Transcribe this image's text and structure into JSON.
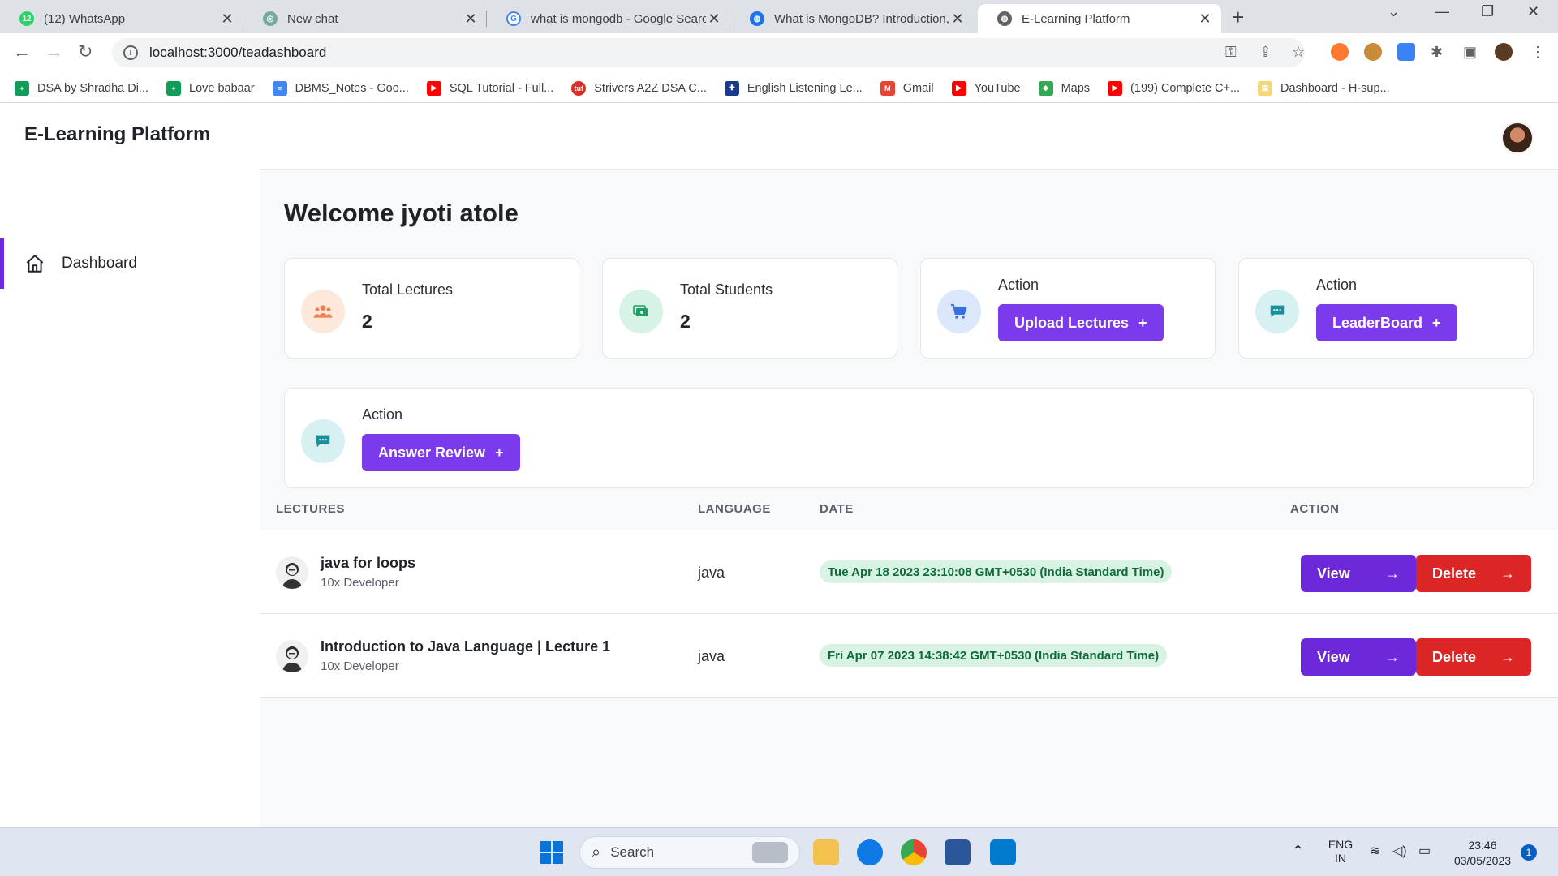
{
  "browser": {
    "tabs": [
      {
        "title": "(12) WhatsApp",
        "icon": "whatsapp-icon",
        "badge": "12"
      },
      {
        "title": "New chat",
        "icon": "chatgpt-icon"
      },
      {
        "title": "what is mongodb - Google Searc",
        "icon": "google-icon"
      },
      {
        "title": "What is MongoDB? Introduction,",
        "icon": "globe-icon"
      },
      {
        "title": "E-Learning Platform",
        "icon": "globe-icon",
        "active": true
      }
    ],
    "url": "localhost:3000/teadashboard",
    "bookmarks": [
      {
        "label": "DSA by Shradha Di...",
        "icon": "sheets-icon"
      },
      {
        "label": "Love babaar",
        "icon": "sheets-icon"
      },
      {
        "label": "DBMS_Notes - Goo...",
        "icon": "docs-icon"
      },
      {
        "label": "SQL Tutorial - Full...",
        "icon": "youtube-icon"
      },
      {
        "label": "Strivers A2Z DSA C...",
        "icon": "tuf-icon"
      },
      {
        "label": "English Listening Le...",
        "icon": "uk-flag-icon"
      },
      {
        "label": "Gmail",
        "icon": "gmail-icon"
      },
      {
        "label": "YouTube",
        "icon": "youtube-icon"
      },
      {
        "label": "Maps",
        "icon": "maps-icon"
      },
      {
        "label": "(199) Complete C+...",
        "icon": "youtube-icon"
      },
      {
        "label": "Dashboard - H-sup...",
        "icon": "dashboard-icon"
      }
    ]
  },
  "app": {
    "brand": "E-Learning Platform",
    "sidebar": {
      "items": [
        {
          "label": "Dashboard",
          "icon": "home-icon",
          "active": true
        }
      ]
    },
    "welcome": "Welcome jyoti atole",
    "stats": [
      {
        "label": "Total Lectures",
        "value": "2"
      },
      {
        "label": "Total Students",
        "value": "2"
      }
    ],
    "actions": [
      {
        "label": "Action",
        "button": "Upload Lectures",
        "plus": "+"
      },
      {
        "label": "Action",
        "button": "LeaderBoard",
        "plus": "+"
      },
      {
        "label": "Action",
        "button": "Answer Review",
        "plus": "+"
      }
    ],
    "table": {
      "headers": [
        "LECTURES",
        "LANGUAGE",
        "DATE",
        "ACTION"
      ],
      "rows": [
        {
          "title": "java for loops",
          "subtitle": "10x Developer",
          "language": "java",
          "date": "Tue Apr 18 2023 23:10:08 GMT+0530 (India Standard Time)",
          "view": "View",
          "delete": "Delete"
        },
        {
          "title": "Introduction to Java Language | Lecture 1",
          "subtitle": "10x Developer",
          "language": "java",
          "date": "Fri Apr 07 2023 14:38:42 GMT+0530 (India Standard Time)",
          "view": "View",
          "delete": "Delete"
        }
      ]
    },
    "colors": {
      "accent": "#7c3aed",
      "danger": "#dc2626",
      "date_bg": "#d8f3e3",
      "date_text": "#0f6b3a"
    }
  },
  "taskbar": {
    "search": "Search",
    "lang_top": "ENG",
    "lang_bottom": "IN",
    "time": "23:46",
    "date": "03/05/2023",
    "notification_count": "1"
  }
}
